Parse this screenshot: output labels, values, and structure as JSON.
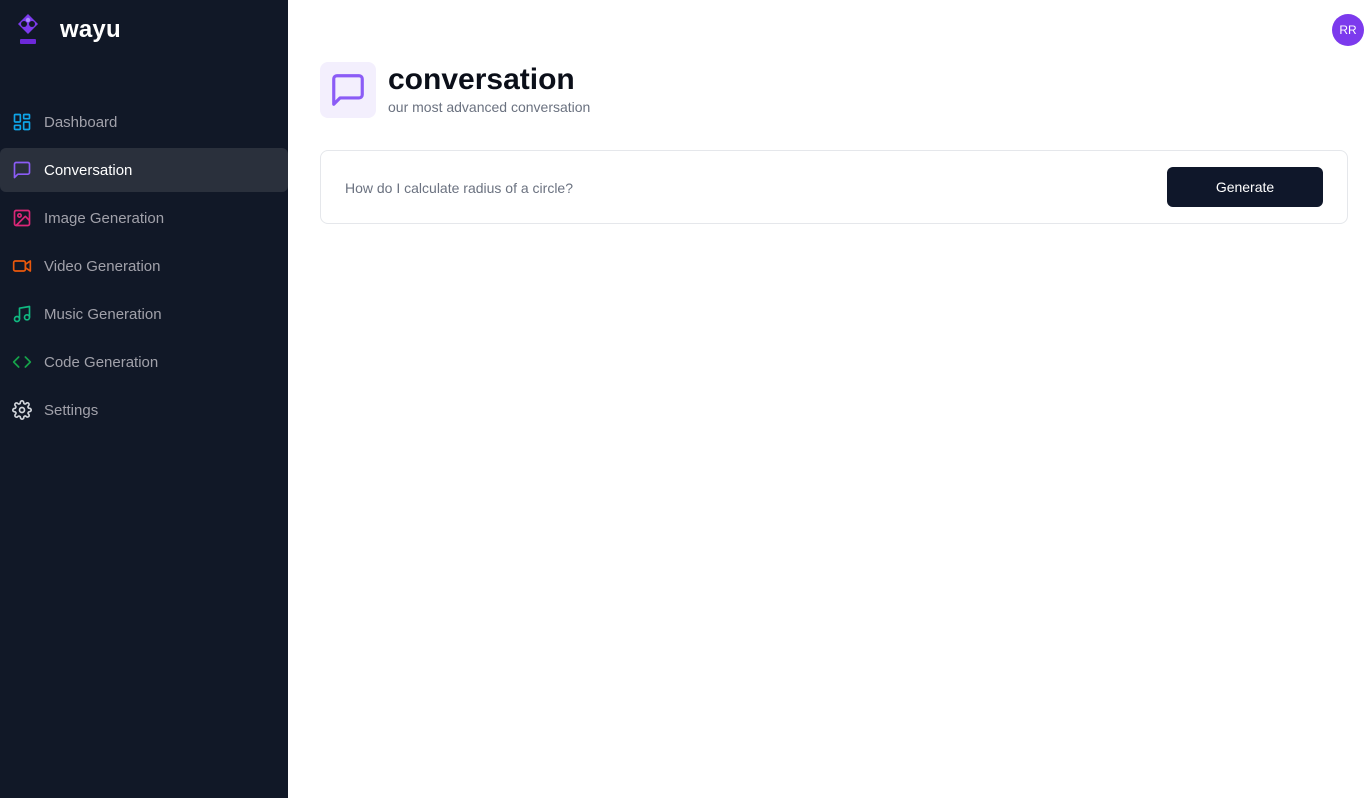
{
  "brand": {
    "name": "wayu",
    "logo_icon": "brand-logo-icon",
    "logo_color": "#7c3aed"
  },
  "sidebar": {
    "items": [
      {
        "label": "Dashboard",
        "icon": "dashboard-icon",
        "color": "#0ea5e9",
        "active": false
      },
      {
        "label": "Conversation",
        "icon": "chat-bubble-icon",
        "color": "#8b5cf6",
        "active": true
      },
      {
        "label": "Image Generation",
        "icon": "image-icon",
        "color": "#db2777",
        "active": false
      },
      {
        "label": "Video Generation",
        "icon": "video-icon",
        "color": "#ea580c",
        "active": false
      },
      {
        "label": "Music Generation",
        "icon": "music-icon",
        "color": "#10b981",
        "active": false
      },
      {
        "label": "Code Generation",
        "icon": "code-icon",
        "color": "#16a34a",
        "active": false
      },
      {
        "label": "Settings",
        "icon": "gear-icon",
        "color": "#d1d5db",
        "active": false
      }
    ]
  },
  "header": {
    "avatar_initials": "RR",
    "avatar_color": "#7c3aed"
  },
  "page": {
    "title": "conversation",
    "subtitle": "our most advanced conversation",
    "icon": "chat-bubble-icon",
    "icon_color": "#8b5cf6"
  },
  "prompt": {
    "placeholder": "How do I calculate radius of a circle?",
    "value": "",
    "button_label": "Generate"
  }
}
